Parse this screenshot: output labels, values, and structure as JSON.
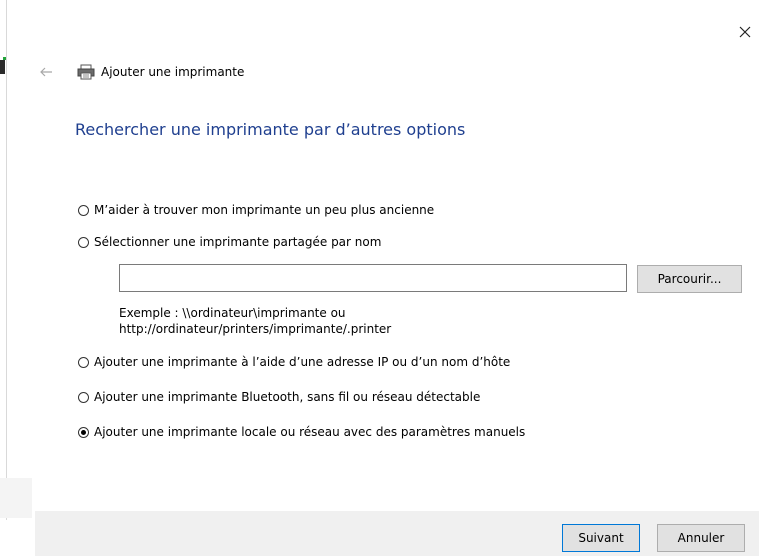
{
  "window": {
    "title": "Ajouter une imprimante"
  },
  "heading": "Rechercher une imprimante par d’autres options",
  "options": [
    {
      "label": "M’aider à trouver mon imprimante un peu plus ancienne",
      "selected": false
    },
    {
      "label": "Sélectionner une imprimante partagée par nom",
      "selected": false
    },
    {
      "label": "Ajouter une imprimante à l’aide d’une adresse IP ou d’un nom d’hôte",
      "selected": false
    },
    {
      "label": "Ajouter une imprimante Bluetooth, sans fil ou réseau détectable",
      "selected": false
    },
    {
      "label": "Ajouter une imprimante locale ou réseau avec des paramètres manuels",
      "selected": true
    }
  ],
  "shared_name": {
    "value": "",
    "browse_label": "Parcourir...",
    "example_line1": "Exemple : \\\\ordinateur\\imprimante ou",
    "example_line2": "http://ordinateur/printers/imprimante/.printer"
  },
  "footer": {
    "next_label": "Suivant",
    "cancel_label": "Annuler"
  },
  "icons": {
    "close": "close-icon",
    "back": "back-arrow-icon",
    "printer": "printer-icon"
  },
  "colors": {
    "heading": "#1f3f8f",
    "accent": "#0078d7",
    "footer_bg": "#f0f0f0",
    "button_bg": "#e1e1e1"
  }
}
